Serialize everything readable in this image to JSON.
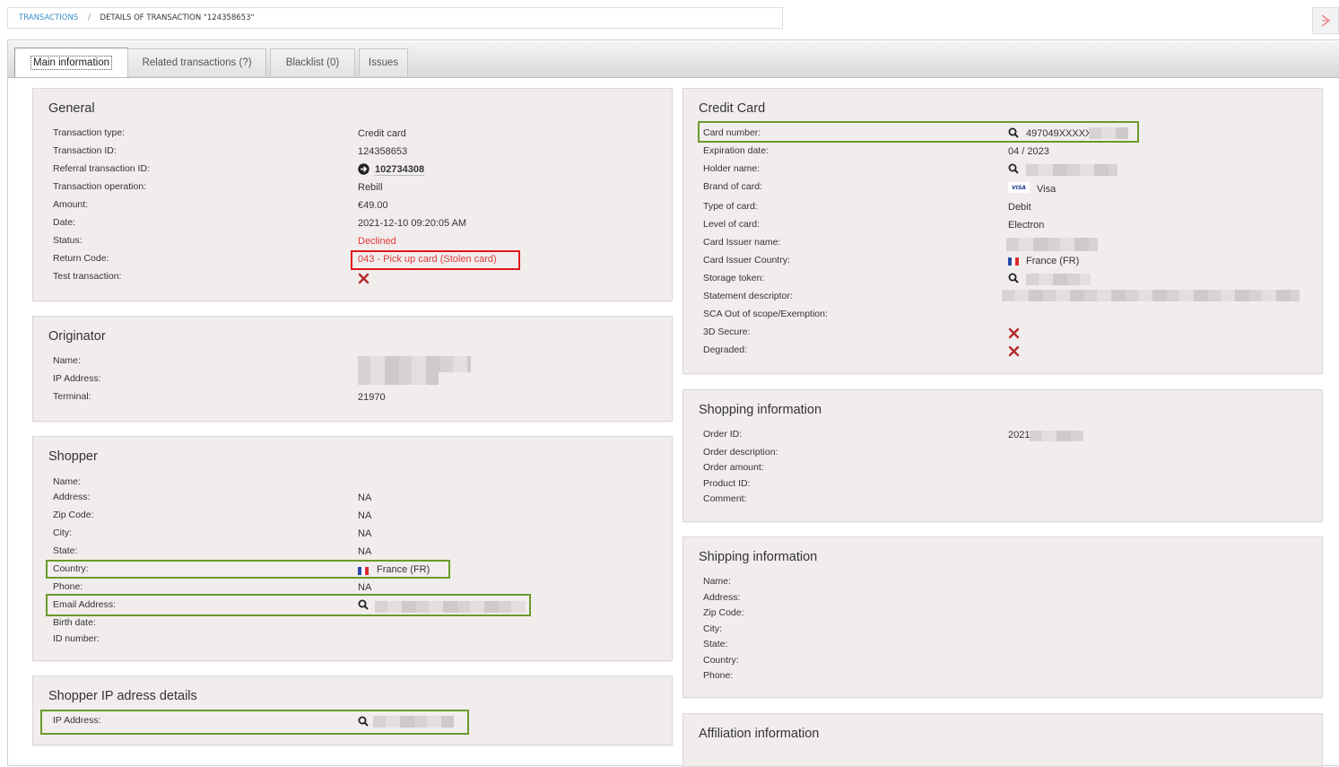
{
  "breadcrumb": {
    "link": "TRANSACTIONS",
    "separator": "/",
    "current": "DETAILS OF TRANSACTION \"124358653\""
  },
  "tabs": [
    "Main information",
    "Related transactions (?)",
    "Blacklist (0)",
    "Issues"
  ],
  "colors": {
    "panel_bg": "#f2eded",
    "highlight_green": "#6a9a2a",
    "highlight_red": "#e0151a",
    "link": "#3a8fc7",
    "declined": "#e03a3a"
  },
  "general": {
    "title": "General",
    "labels": [
      "Transaction type:",
      "Transaction ID:",
      "Referral transaction ID:",
      "Transaction operation:",
      "Amount:",
      "Date:",
      "Status:",
      "Return Code:",
      "Test transaction:"
    ],
    "transaction_type": "Credit card",
    "transaction_id": "124358653",
    "referral_id": "102734308",
    "operation": "Rebill",
    "amount": "€49.00",
    "date": "2021-12-10 09:20:05 AM",
    "status": "Declined",
    "return_code": "043 - Pick up card (Stolen card)",
    "test_transaction_icon": "x-icon"
  },
  "originator": {
    "title": "Originator",
    "labels": [
      "Name:",
      "IP Address:",
      "Terminal:"
    ],
    "terminal": "21970"
  },
  "shopper": {
    "title": "Shopper",
    "labels": [
      "Name:",
      "Address:",
      "Zip Code:",
      "City:",
      "State:",
      "Country:",
      "Phone:",
      "Email Address:",
      "Birth date:",
      "ID number:"
    ],
    "address": "NA",
    "zip": "NA",
    "city": "NA",
    "state": "NA",
    "country": "France (FR)",
    "phone": "NA"
  },
  "shopper_ip": {
    "title": "Shopper IP adress details",
    "labels": [
      "IP Address:"
    ]
  },
  "credit_card": {
    "title": "Credit Card",
    "labels": [
      "Card number:",
      "Expiration date:",
      "Holder name:",
      "Brand of card:",
      "Type of card:",
      "Level of card:",
      "Card Issuer name:",
      "Card Issuer Country:",
      "Storage token:",
      "Statement descriptor:",
      "SCA Out of scope/Exemption:",
      "3D Secure:",
      "Degraded:"
    ],
    "card_number": "497049XXXXXX",
    "expiration": "04 / 2023",
    "brand_logo": "VISA",
    "brand": "Visa",
    "type": "Debit",
    "level": "Electron",
    "issuer_country": "France (FR)"
  },
  "shopping": {
    "title": "Shopping information",
    "labels": [
      "Order ID:",
      "Order description:",
      "Order amount:",
      "Product ID:",
      "Comment:"
    ],
    "order_id_prefix": "2021"
  },
  "shipping": {
    "title": "Shipping information",
    "labels": [
      "Name:",
      "Address:",
      "Zip Code:",
      "City:",
      "State:",
      "Country:",
      "Phone:"
    ]
  },
  "affiliation": {
    "title": "Affiliation information"
  }
}
